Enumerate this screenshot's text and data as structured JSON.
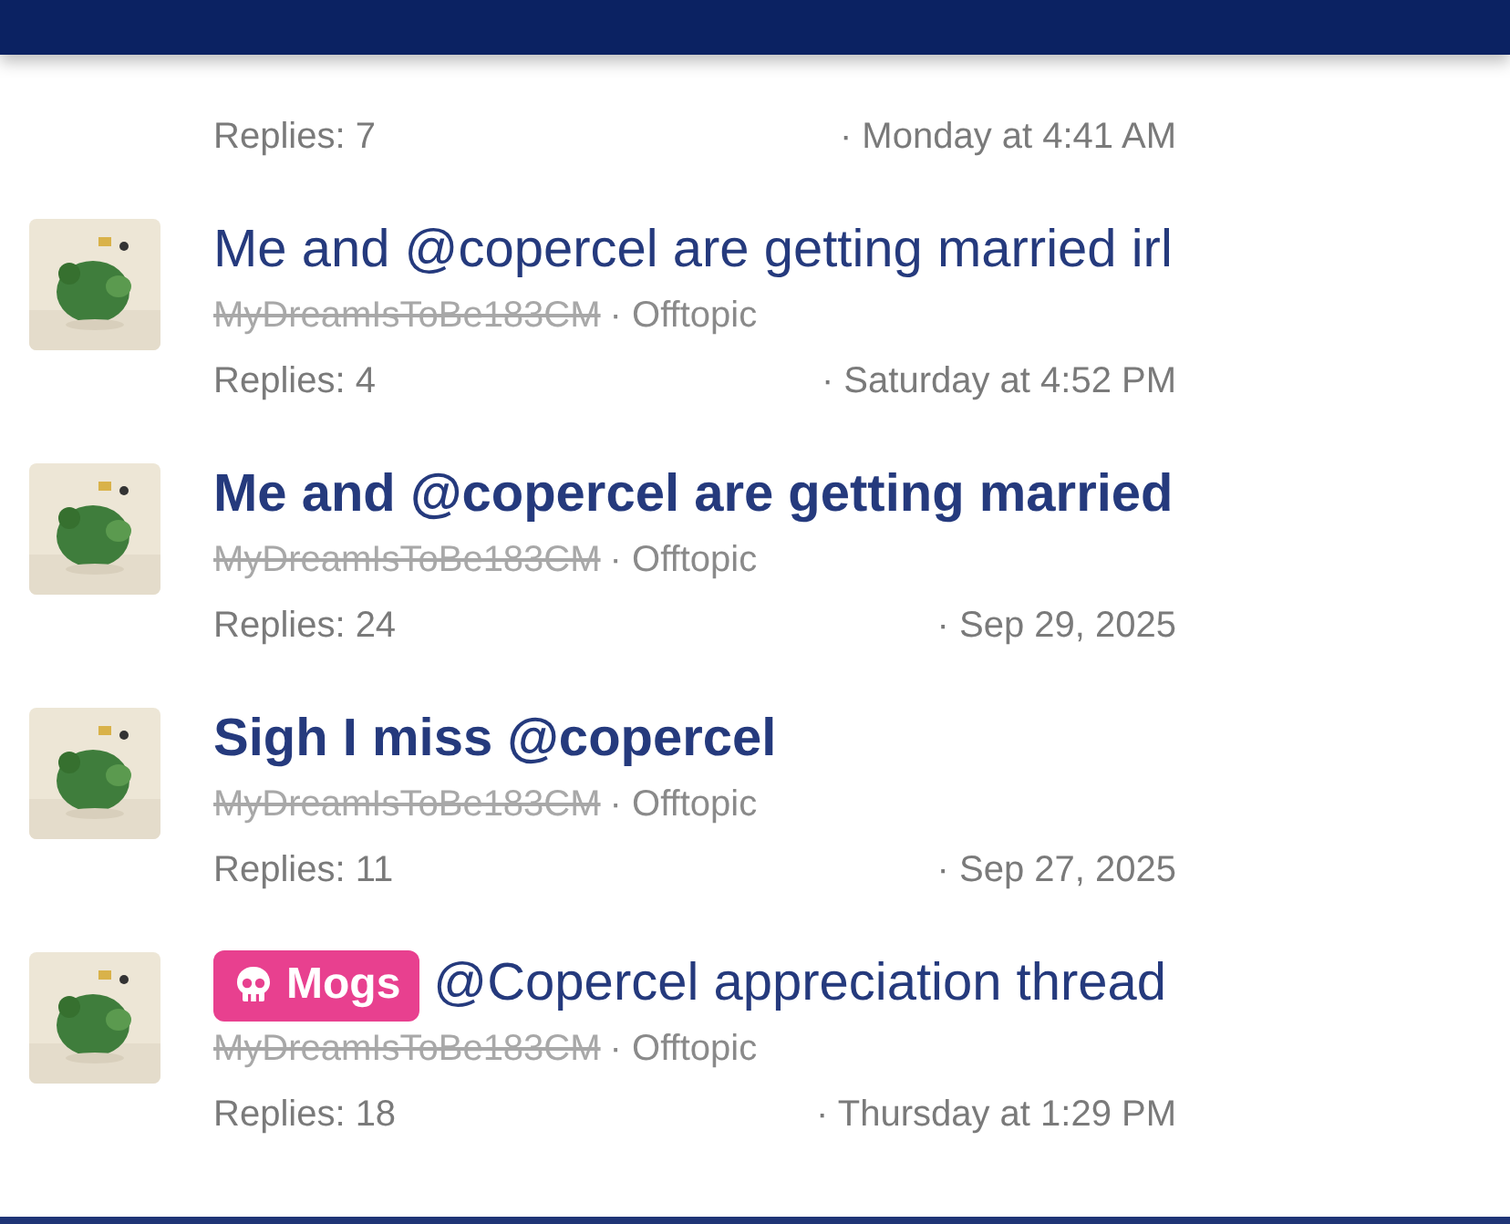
{
  "threads": [
    {
      "replies": "Replies: 7",
      "date": "· Monday at 4:41 AM",
      "partial": true
    },
    {
      "title": "Me and @copercel are getting married irl",
      "unread": false,
      "author": "MyDreamIsToBe183CM",
      "author_banned": true,
      "forum": "· Offtopic",
      "replies": "Replies: 4",
      "date": "· Saturday at 4:52 PM"
    },
    {
      "title": "Me and @copercel are getting married",
      "unread": true,
      "author": "MyDreamIsToBe183CM",
      "author_banned": true,
      "forum": "· Offtopic",
      "replies": "Replies: 24",
      "date": "· Sep 29, 2025"
    },
    {
      "title": "Sigh I miss @copercel",
      "unread": true,
      "author": "MyDreamIsToBe183CM",
      "author_banned": true,
      "forum": "· Offtopic",
      "replies": "Replies: 11",
      "date": "· Sep 27, 2025"
    },
    {
      "prefix": "Mogs",
      "title": "@Copercel appreciation thread",
      "unread": false,
      "author": "MyDreamIsToBe183CM",
      "author_banned": true,
      "forum": "· Offtopic",
      "replies": "Replies: 18",
      "date": "· Thursday at 1:29 PM"
    }
  ]
}
